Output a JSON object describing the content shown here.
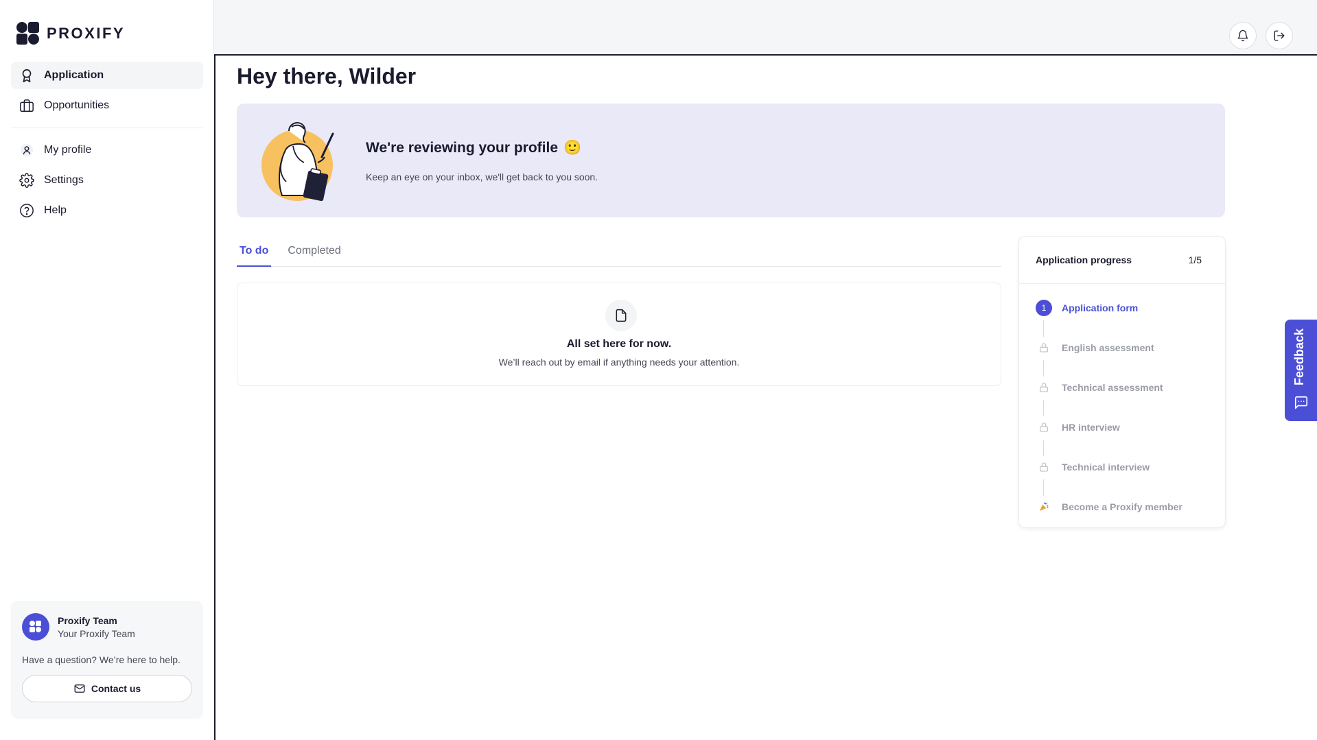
{
  "brand": {
    "name": "PROXIFY"
  },
  "sidebar": {
    "items": [
      {
        "label": "Application",
        "icon": "award-icon",
        "active": true
      },
      {
        "label": "Opportunities",
        "icon": "briefcase-icon",
        "active": false
      },
      {
        "label": "My profile",
        "icon": "user-icon",
        "active": false
      },
      {
        "label": "Settings",
        "icon": "gear-icon",
        "active": false
      },
      {
        "label": "Help",
        "icon": "help-circle-icon",
        "active": false
      }
    ],
    "team": {
      "name": "Proxify Team",
      "subtitle": "Your Proxify Team",
      "question": "Have a question? We’re here to help.",
      "contact_label": "Contact us"
    }
  },
  "header": {
    "notifications_icon": "bell-icon",
    "logout_icon": "logout-icon"
  },
  "main": {
    "greeting": "Hey there, Wilder",
    "banner": {
      "title": "We're reviewing your profile",
      "emoji": "🙂",
      "subtitle": "Keep an eye on your inbox, we'll get back to you soon."
    },
    "tabs": [
      {
        "label": "To do",
        "active": true
      },
      {
        "label": "Completed",
        "active": false
      }
    ],
    "empty_state": {
      "title": "All set here for now.",
      "subtitle": "We’ll reach out by email if anything needs your attention."
    }
  },
  "progress": {
    "title": "Application progress",
    "count": "1/5",
    "current_step_number": "1",
    "steps": [
      {
        "label": "Application form",
        "state": "current"
      },
      {
        "label": "English assessment",
        "state": "locked"
      },
      {
        "label": "Technical assessment",
        "state": "locked"
      },
      {
        "label": "HR interview",
        "state": "locked"
      },
      {
        "label": "Technical interview",
        "state": "locked"
      },
      {
        "label": "Become a Proxify member",
        "state": "final"
      }
    ]
  },
  "feedback": {
    "label": "Feedback"
  },
  "colors": {
    "accent": "#4b4fd6",
    "banner_bg": "#e9e9f8",
    "text": "#1a1b2e",
    "muted": "#9a9ca7"
  }
}
